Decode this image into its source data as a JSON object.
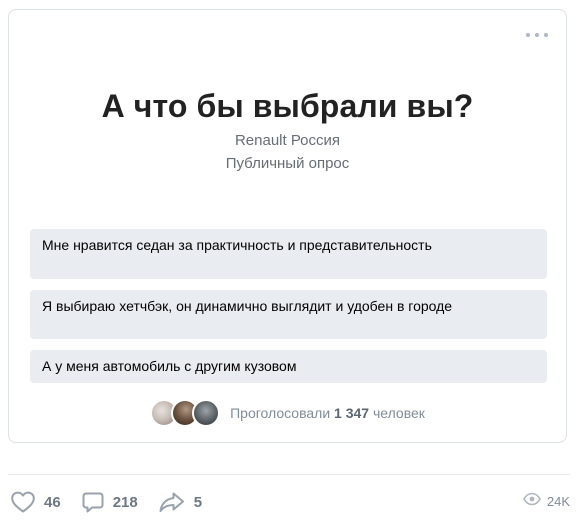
{
  "poll": {
    "title": "А что бы выбрали вы?",
    "author": "Renault Россия",
    "type": "Публичный опрос",
    "options": [
      "Мне нравится седан за практичность и представительность",
      "Я выбираю хетчбэк, он динамично выглядит и удобен в городе",
      "А у меня автомобиль с другим кузовом"
    ],
    "voters": {
      "prefix": "Проголосовали",
      "count": "1 347",
      "suffix": "человек"
    }
  },
  "actions": {
    "likes": "46",
    "comments": "218",
    "shares": "5",
    "views": "24K"
  },
  "icons": {
    "menu": "more-dots-icon",
    "like": "heart-icon",
    "comment": "comment-icon",
    "share": "share-arrow-icon",
    "views": "eye-icon"
  },
  "colors": {
    "option_bg": "#e9ecf0",
    "muted_text": "#818c99",
    "icon": "#99a2ad"
  }
}
